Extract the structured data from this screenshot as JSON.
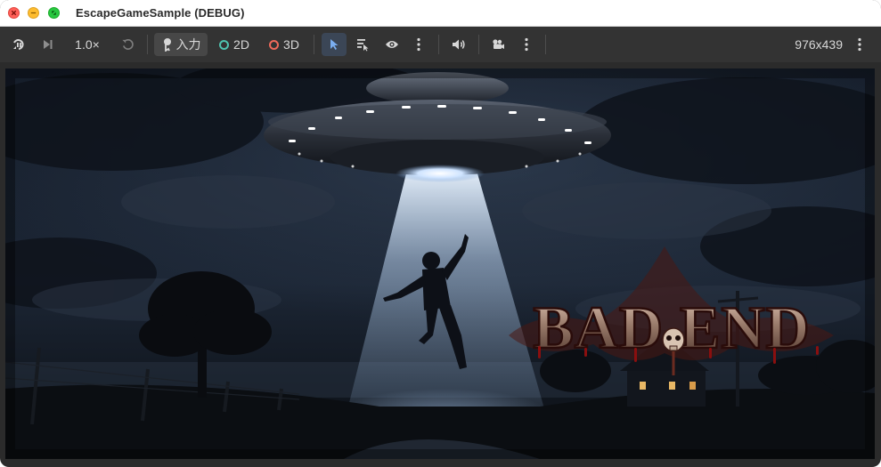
{
  "window": {
    "title": "EscapeGameSample (DEBUG)"
  },
  "toolbar": {
    "speed_label": "1.0×",
    "input_label": "入力",
    "mode_2d_label": "2D",
    "mode_3d_label": "3D",
    "resolution_label": "976x439"
  },
  "colors": {
    "accent_blue": "#7aaef0",
    "ring_2d": "#4fc3b0",
    "ring_3d": "#f06a5a",
    "title_blood": "#8a0f0f"
  },
  "scene": {
    "logo_text": "BAD END"
  }
}
